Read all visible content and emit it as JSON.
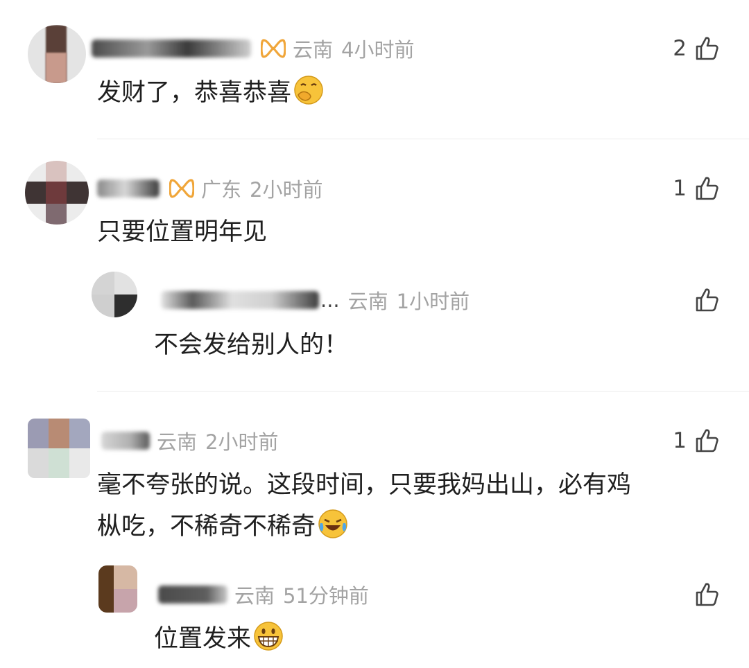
{
  "comments": [
    {
      "region": "云南",
      "time": "4小时前",
      "likes": "2",
      "text": "发财了，恭喜恭喜",
      "emoji": "thinking-hand-emoji"
    },
    {
      "region": "广东",
      "time": "2小时前",
      "likes": "1",
      "text": "只要位置明年见",
      "reply": {
        "ellipsis": "...",
        "region": "云南",
        "time": "1小时前",
        "text": "不会发给别人的！"
      }
    },
    {
      "region": "云南",
      "time": "2小时前",
      "likes": "1",
      "text_line1": "毫不夸张的说。这段时间，只要我妈出山，必有鸡",
      "text_line2": "枞吃，不稀奇不稀奇",
      "emoji": "crying-laughing-emoji",
      "reply": {
        "region": "云南",
        "time": "51分钟前",
        "text": "位置发来",
        "emoji": "grinning-emoji"
      }
    }
  ],
  "colors": {
    "meta_text": "#a3a3a3",
    "content_text": "#1f1f1f",
    "vip_orange": "#f0a63a",
    "divider": "#ececec"
  },
  "icons": {
    "like": "thumbs-up-outline-icon",
    "vip": "vip-loop-icon"
  }
}
